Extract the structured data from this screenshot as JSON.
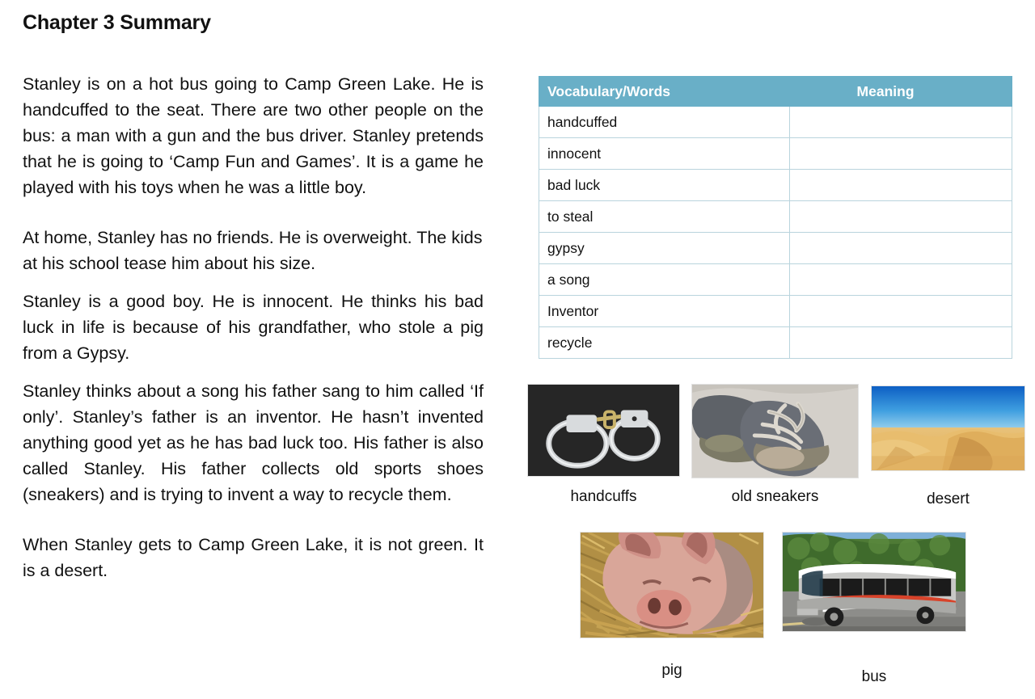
{
  "document": {
    "title": "Chapter 3 Summary",
    "summary_paragraphs": [
      "Stanley is on a hot bus going to Camp Green Lake. He is handcuffed to the seat. There are two other people on the bus: a man with a gun and the bus driver. Stanley pretends that he is going to ‘Camp Fun and Games’. It is a game he played with his toys when he was a little boy.",
      "At home, Stanley has no friends. He is overweight. The kids at his school tease him about his size.",
      "Stanley is a good boy. He is innocent. He thinks his bad luck in life is because of his grandfather, who stole a pig from a Gypsy.",
      "Stanley thinks about a song his father sang to him called ‘If only’. Stanley’s father is an inventor. He hasn’t invented anything good yet as he has bad luck too. His father is also called Stanley. His father collects old sports shoes (sneakers) and is trying to invent a way to recycle them.",
      "When Stanley gets to Camp Green Lake, it is not green. It is a desert."
    ]
  },
  "vocabulary_table": {
    "header_color": "#69afc7",
    "border_color": "#b9d4dd",
    "columns": [
      "Vocabulary/Words",
      "Meaning"
    ],
    "rows": [
      {
        "word": "handcuffed",
        "meaning": ""
      },
      {
        "word": "innocent",
        "meaning": ""
      },
      {
        "word": "bad luck",
        "meaning": ""
      },
      {
        "word": "to steal",
        "meaning": ""
      },
      {
        "word": "gypsy",
        "meaning": ""
      },
      {
        "word": "a song",
        "meaning": ""
      },
      {
        "word": "Inventor",
        "meaning": ""
      },
      {
        "word": "recycle",
        "meaning": ""
      }
    ]
  },
  "pictures": [
    {
      "id": "handcuffs",
      "caption": "handcuffs",
      "image_name": "handcuffs-photo"
    },
    {
      "id": "sneakers",
      "caption": "old sneakers",
      "image_name": "old-sneakers-photo"
    },
    {
      "id": "desert",
      "caption": "desert",
      "image_name": "desert-photo"
    },
    {
      "id": "pig",
      "caption": "pig",
      "image_name": "pig-photo"
    },
    {
      "id": "bus",
      "caption": "bus",
      "image_name": "bus-photo"
    }
  ]
}
